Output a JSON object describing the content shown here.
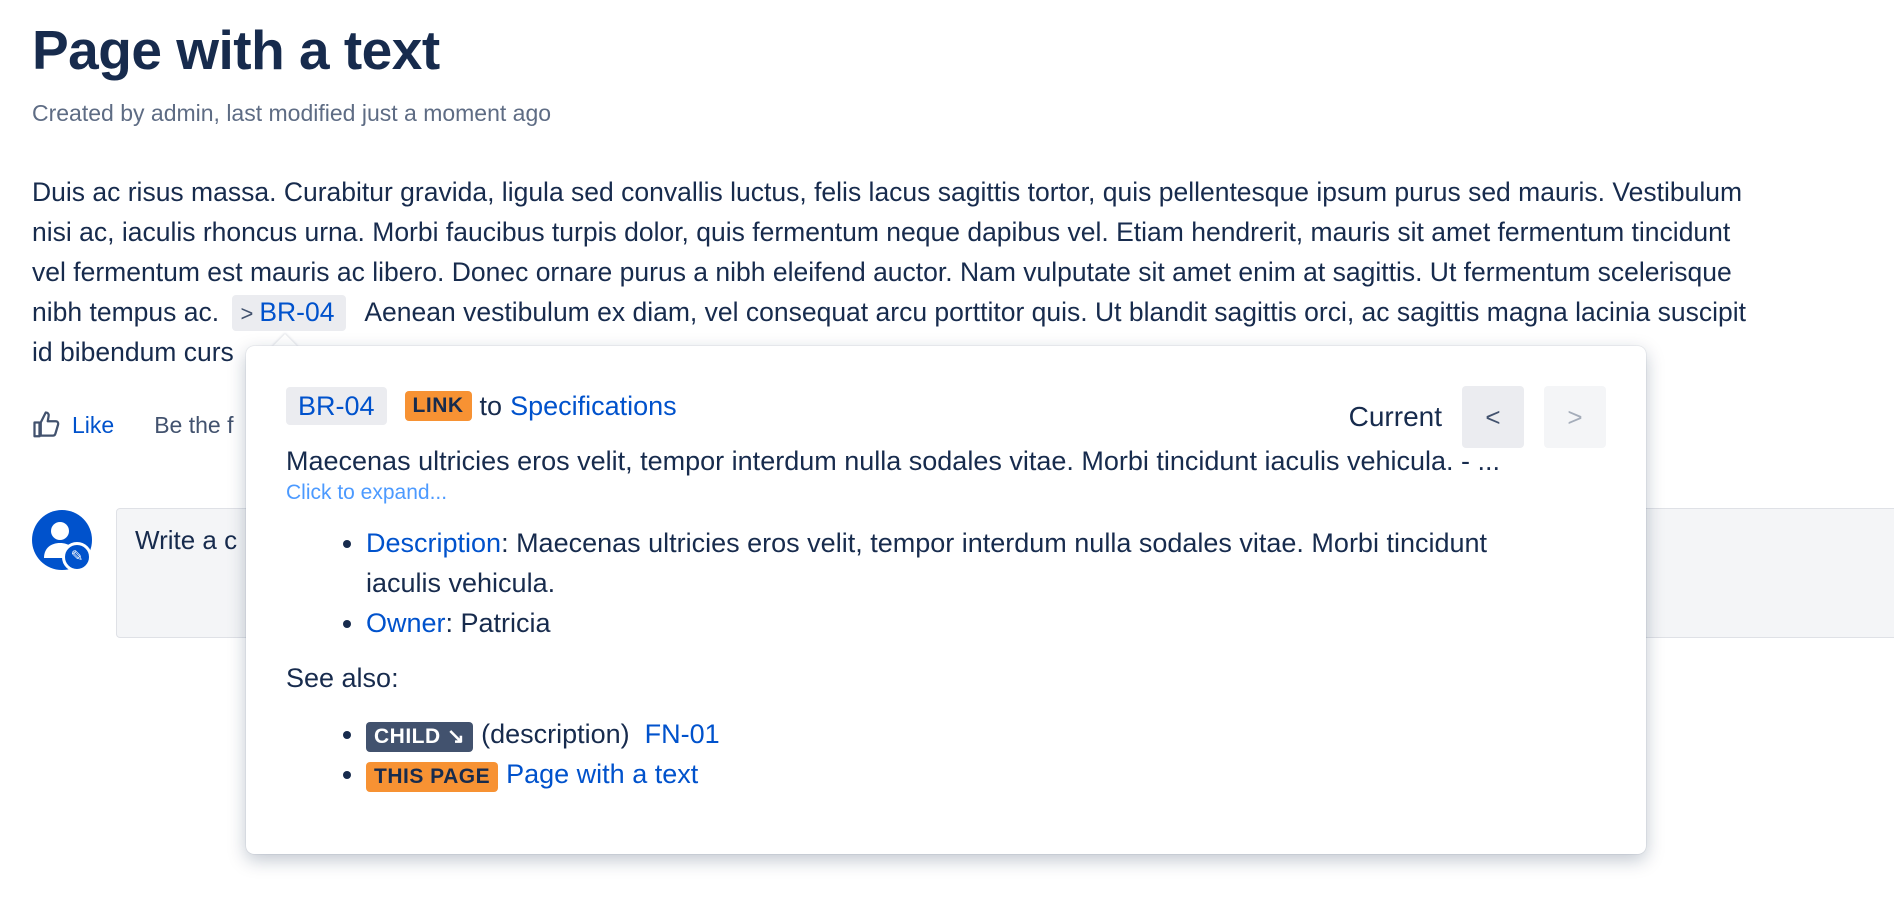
{
  "page": {
    "title": "Page with a text",
    "byline": "Created by admin, last modified just a moment ago"
  },
  "body": {
    "line1": "Duis ac risus massa. Curabitur gravida, ligula sed convallis luctus, felis lacus sagittis tortor, quis pellentesque ipsum purus sed mauris. Vestibulum",
    "line2": "nisi ac, iaculis rhoncus urna. Morbi faucibus turpis dolor, quis fermentum neque dapibus vel. Etiam hendrerit, mauris sit amet fermentum tincidunt",
    "line3": "vel fermentum est mauris ac libero. Donec ornare purus a nibh eleifend auctor. Nam vulputate sit amet enim at sagittis. Ut fermentum scelerisque",
    "line4_before": "nibh tempus ac.",
    "line4_chip_chevron": ">",
    "line4_chip": "BR-04",
    "line4_after": "Aenean vestibulum ex diam, vel consequat arcu porttitor quis. Ut blandit sagittis orci, ac sagittis magna lacinia suscipit",
    "line5": "id bibendum curs"
  },
  "actions": {
    "like_label": "Like",
    "like_hint": "Be the f"
  },
  "comment": {
    "placeholder": "Write a c"
  },
  "popup": {
    "issue_key": "BR-04",
    "link_lozenge": "LINK",
    "to_text": "to",
    "target": "Specifications",
    "current_label": "Current",
    "prev_label": "<",
    "next_label": ">",
    "summary": "Maecenas ultricies eros velit, tempor interdum nulla sodales vitae. Morbi tincidunt iaculis vehicula. - ...",
    "expand_label": "Click to expand...",
    "fields": [
      {
        "name": "Description",
        "value": ": Maecenas ultricies eros velit, tempor interdum nulla sodales vitae. Morbi tincidunt",
        "value_cont": "iaculis vehicula."
      },
      {
        "name": "Owner",
        "value": ": Patricia"
      }
    ],
    "see_also_label": "See also:",
    "related": [
      {
        "lozenge": "CHILD ↘",
        "text": "(description)",
        "link": "FN-01"
      },
      {
        "lozenge": "THIS PAGE",
        "text": "",
        "link": "Page with a text"
      }
    ]
  },
  "colors": {
    "link": "#0052cc",
    "orange_lozenge": "#f79233",
    "dark_lozenge": "#42526e",
    "text": "#172b4d"
  }
}
